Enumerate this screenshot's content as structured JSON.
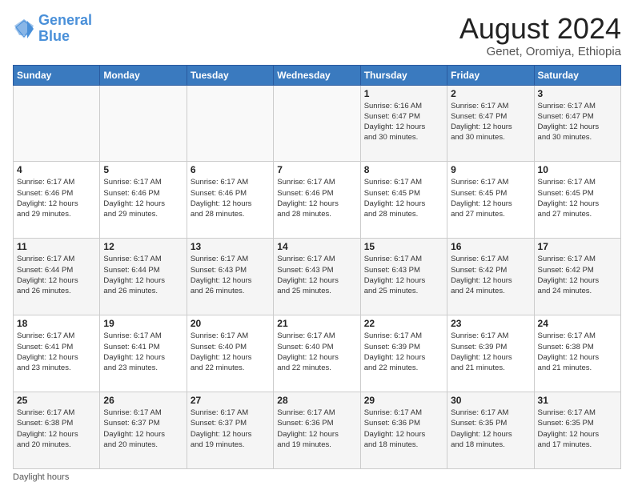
{
  "logo": {
    "line1": "General",
    "line2": "Blue"
  },
  "title": "August 2024",
  "subtitle": "Genet, Oromiya, Ethiopia",
  "days_of_week": [
    "Sunday",
    "Monday",
    "Tuesday",
    "Wednesday",
    "Thursday",
    "Friday",
    "Saturday"
  ],
  "weeks": [
    [
      {
        "day": "",
        "info": ""
      },
      {
        "day": "",
        "info": ""
      },
      {
        "day": "",
        "info": ""
      },
      {
        "day": "",
        "info": ""
      },
      {
        "day": "1",
        "info": "Sunrise: 6:16 AM\nSunset: 6:47 PM\nDaylight: 12 hours\nand 30 minutes."
      },
      {
        "day": "2",
        "info": "Sunrise: 6:17 AM\nSunset: 6:47 PM\nDaylight: 12 hours\nand 30 minutes."
      },
      {
        "day": "3",
        "info": "Sunrise: 6:17 AM\nSunset: 6:47 PM\nDaylight: 12 hours\nand 30 minutes."
      }
    ],
    [
      {
        "day": "4",
        "info": "Sunrise: 6:17 AM\nSunset: 6:46 PM\nDaylight: 12 hours\nand 29 minutes."
      },
      {
        "day": "5",
        "info": "Sunrise: 6:17 AM\nSunset: 6:46 PM\nDaylight: 12 hours\nand 29 minutes."
      },
      {
        "day": "6",
        "info": "Sunrise: 6:17 AM\nSunset: 6:46 PM\nDaylight: 12 hours\nand 28 minutes."
      },
      {
        "day": "7",
        "info": "Sunrise: 6:17 AM\nSunset: 6:46 PM\nDaylight: 12 hours\nand 28 minutes."
      },
      {
        "day": "8",
        "info": "Sunrise: 6:17 AM\nSunset: 6:45 PM\nDaylight: 12 hours\nand 28 minutes."
      },
      {
        "day": "9",
        "info": "Sunrise: 6:17 AM\nSunset: 6:45 PM\nDaylight: 12 hours\nand 27 minutes."
      },
      {
        "day": "10",
        "info": "Sunrise: 6:17 AM\nSunset: 6:45 PM\nDaylight: 12 hours\nand 27 minutes."
      }
    ],
    [
      {
        "day": "11",
        "info": "Sunrise: 6:17 AM\nSunset: 6:44 PM\nDaylight: 12 hours\nand 26 minutes."
      },
      {
        "day": "12",
        "info": "Sunrise: 6:17 AM\nSunset: 6:44 PM\nDaylight: 12 hours\nand 26 minutes."
      },
      {
        "day": "13",
        "info": "Sunrise: 6:17 AM\nSunset: 6:43 PM\nDaylight: 12 hours\nand 26 minutes."
      },
      {
        "day": "14",
        "info": "Sunrise: 6:17 AM\nSunset: 6:43 PM\nDaylight: 12 hours\nand 25 minutes."
      },
      {
        "day": "15",
        "info": "Sunrise: 6:17 AM\nSunset: 6:43 PM\nDaylight: 12 hours\nand 25 minutes."
      },
      {
        "day": "16",
        "info": "Sunrise: 6:17 AM\nSunset: 6:42 PM\nDaylight: 12 hours\nand 24 minutes."
      },
      {
        "day": "17",
        "info": "Sunrise: 6:17 AM\nSunset: 6:42 PM\nDaylight: 12 hours\nand 24 minutes."
      }
    ],
    [
      {
        "day": "18",
        "info": "Sunrise: 6:17 AM\nSunset: 6:41 PM\nDaylight: 12 hours\nand 23 minutes."
      },
      {
        "day": "19",
        "info": "Sunrise: 6:17 AM\nSunset: 6:41 PM\nDaylight: 12 hours\nand 23 minutes."
      },
      {
        "day": "20",
        "info": "Sunrise: 6:17 AM\nSunset: 6:40 PM\nDaylight: 12 hours\nand 22 minutes."
      },
      {
        "day": "21",
        "info": "Sunrise: 6:17 AM\nSunset: 6:40 PM\nDaylight: 12 hours\nand 22 minutes."
      },
      {
        "day": "22",
        "info": "Sunrise: 6:17 AM\nSunset: 6:39 PM\nDaylight: 12 hours\nand 22 minutes."
      },
      {
        "day": "23",
        "info": "Sunrise: 6:17 AM\nSunset: 6:39 PM\nDaylight: 12 hours\nand 21 minutes."
      },
      {
        "day": "24",
        "info": "Sunrise: 6:17 AM\nSunset: 6:38 PM\nDaylight: 12 hours\nand 21 minutes."
      }
    ],
    [
      {
        "day": "25",
        "info": "Sunrise: 6:17 AM\nSunset: 6:38 PM\nDaylight: 12 hours\nand 20 minutes."
      },
      {
        "day": "26",
        "info": "Sunrise: 6:17 AM\nSunset: 6:37 PM\nDaylight: 12 hours\nand 20 minutes."
      },
      {
        "day": "27",
        "info": "Sunrise: 6:17 AM\nSunset: 6:37 PM\nDaylight: 12 hours\nand 19 minutes."
      },
      {
        "day": "28",
        "info": "Sunrise: 6:17 AM\nSunset: 6:36 PM\nDaylight: 12 hours\nand 19 minutes."
      },
      {
        "day": "29",
        "info": "Sunrise: 6:17 AM\nSunset: 6:36 PM\nDaylight: 12 hours\nand 18 minutes."
      },
      {
        "day": "30",
        "info": "Sunrise: 6:17 AM\nSunset: 6:35 PM\nDaylight: 12 hours\nand 18 minutes."
      },
      {
        "day": "31",
        "info": "Sunrise: 6:17 AM\nSunset: 6:35 PM\nDaylight: 12 hours\nand 17 minutes."
      }
    ]
  ],
  "footer": "Daylight hours"
}
